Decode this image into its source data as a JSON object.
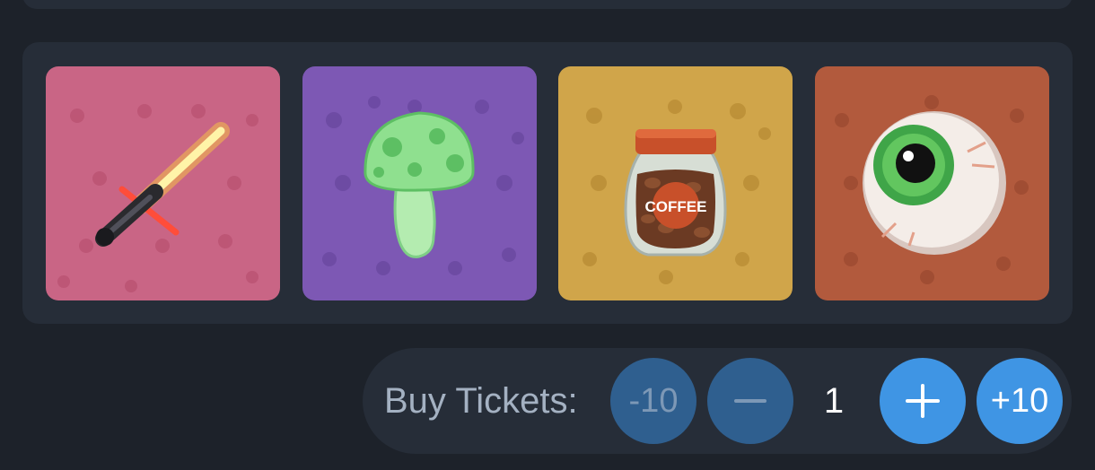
{
  "items": [
    {
      "name": "lightsaber",
      "bg": "#c96585",
      "accent": "#b8506f"
    },
    {
      "name": "mushroom",
      "bg": "#7d58b4",
      "accent": "#6a48a0"
    },
    {
      "name": "coffee-jar",
      "bg": "#d0a54a",
      "accent": "#b98d35",
      "jar_label": "COFFEE"
    },
    {
      "name": "eyeball",
      "bg": "#b25a3d",
      "accent": "#9c4a31"
    }
  ],
  "buy": {
    "label": "Buy Tickets:",
    "minus10_label": "-10",
    "plus10_label": "+10",
    "quantity": "1",
    "minus_icon": "minus-icon",
    "plus_icon": "plus-icon"
  },
  "colors": {
    "background": "#1d222a",
    "panel": "#262d38",
    "button_dim": "#2f5f8f",
    "button_bright": "#3f95e4"
  }
}
